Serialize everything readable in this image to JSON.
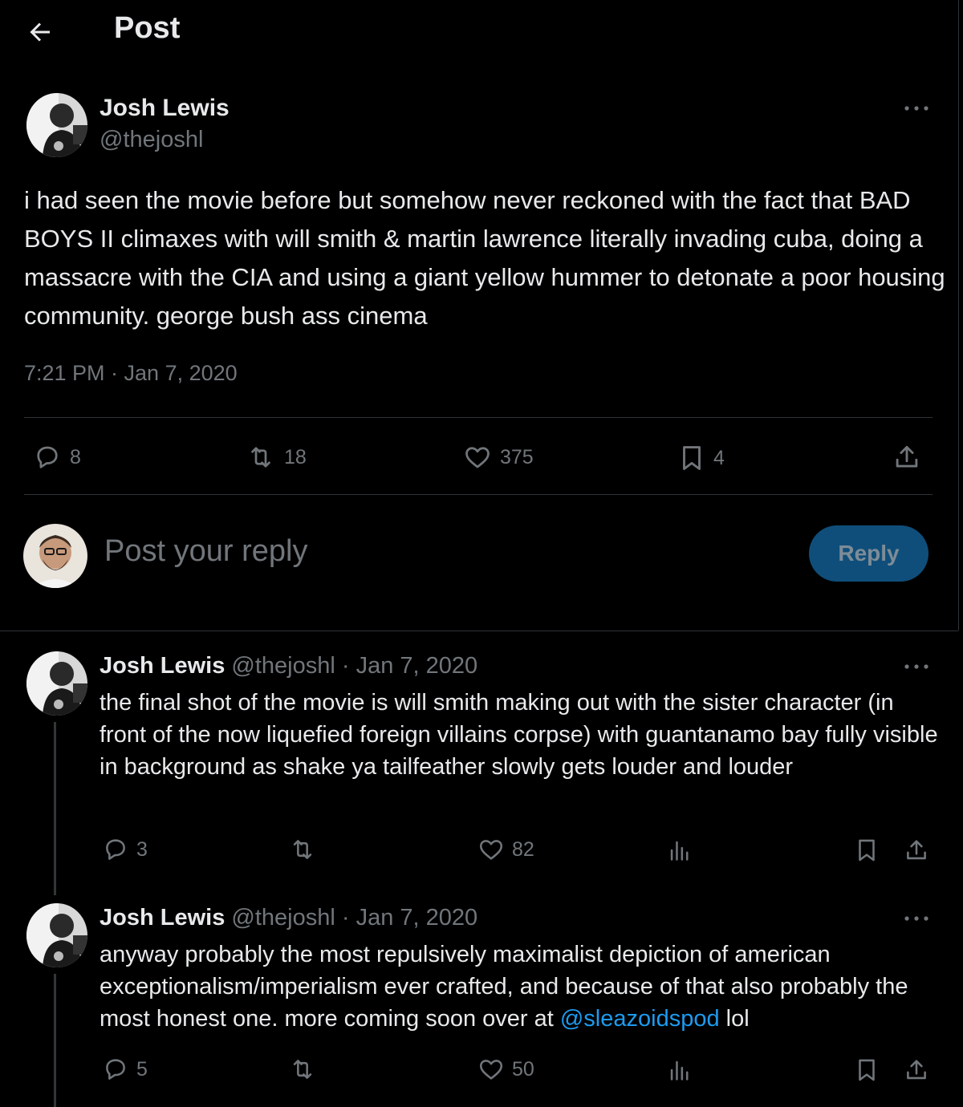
{
  "header": {
    "title": "Post"
  },
  "post": {
    "author": {
      "name": "Josh Lewis",
      "handle": "@thejoshl"
    },
    "text": "i had seen the movie before but somehow never reckoned with the fact that BAD BOYS II climaxes with will smith & martin lawrence literally invading cuba, doing a massacre with the CIA and using a giant yellow hummer to detonate a poor housing community. george bush ass cinema",
    "timestamp": "7:21 PM · Jan 7, 2020",
    "stats": {
      "replies": "8",
      "reposts": "18",
      "likes": "375",
      "bookmarks": "4"
    }
  },
  "composer": {
    "placeholder": "Post your reply",
    "button": "Reply"
  },
  "replies": [
    {
      "name": "Josh Lewis",
      "handle": "@thejoshl",
      "date": "· Jan 7, 2020",
      "text": "the final shot of the movie is will smith making out with the sister character (in front of the now liquefied foreign villains corpse) with guantanamo bay fully visible in background as shake ya tailfeather slowly gets louder and louder",
      "stats": {
        "replies": "3",
        "likes": "82"
      }
    },
    {
      "name": "Josh Lewis",
      "handle": "@thejoshl",
      "date": "· Jan 7, 2020",
      "text_before": "anyway probably the most repulsively maximalist depiction of american exceptionalism/imperialism ever crafted, and because of that also probably the most honest one. more coming soon over at ",
      "mention": "@sleazoidspod",
      "text_after": " lol",
      "stats": {
        "replies": "5",
        "likes": "50"
      }
    }
  ],
  "icons": {
    "back": "arrow-left-icon",
    "more": "more-icon",
    "reply": "reply-icon",
    "repost": "repost-icon",
    "like": "heart-icon",
    "bookmark": "bookmark-icon",
    "share": "share-icon",
    "views": "views-icon"
  },
  "colors": {
    "background": "#000000",
    "text": "#e7e9ea",
    "muted": "#71767b",
    "accent": "#1d9bf0",
    "reply_button": "#0f4e7a"
  }
}
